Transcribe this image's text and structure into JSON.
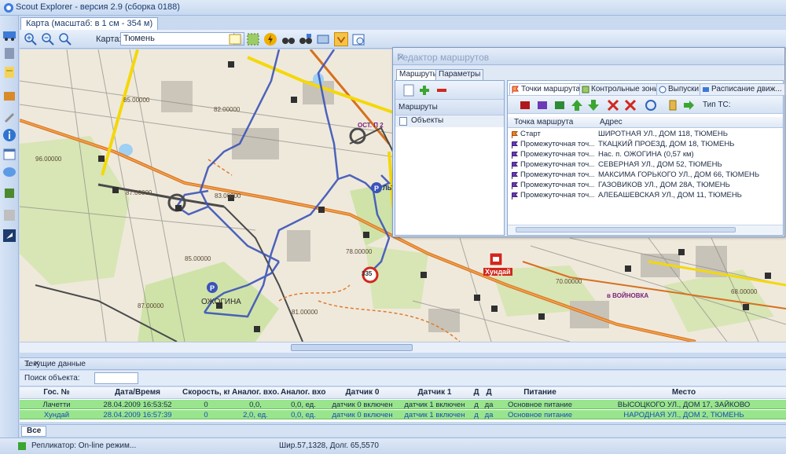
{
  "window": {
    "title": "Scout Explorer - версия 2.9 (сборка 0188)"
  },
  "map_tab": {
    "label": "Карта (масштаб: в 1 см - 354 м)"
  },
  "map_toolbar": {
    "map_label": "Карта:",
    "map_value": "Тюмень"
  },
  "map": {
    "elevations": [
      "85.00000",
      "96.00000",
      "82.00000",
      "87.00000",
      "83.00000",
      "85.00000",
      "87.00000",
      "78.00000",
      "81.00000",
      "70.00000",
      "68.00000"
    ],
    "place_label": "ОЖОГИНА",
    "district_label": "в ВОЙНОВКА",
    "car_label": "Хундай",
    "hotel_label": "ОСТ. П 2",
    "parking_label": "ЛЬТ",
    "cam_label": "335"
  },
  "route_editor": {
    "title": "Редактор маршрутов",
    "tabs": [
      "Маршруты",
      "Параметры"
    ],
    "routes_header": "Маршруты",
    "routes": [
      "Объекты"
    ],
    "right_tabs": [
      "Точки маршрута",
      "Контрольные зоны",
      "Выпуски",
      "Расписание  движ..."
    ],
    "ts_type_label": "Тип ТС:",
    "columns": [
      "Точка маршрута",
      "Адрес"
    ],
    "points": [
      {
        "type": "Старт",
        "address": "ШИРОТНАЯ УЛ., ДОМ 118, ТЮМЕНЬ"
      },
      {
        "type": "Промежуточная точ...",
        "address": "ТКАЦКИЙ ПРОЕЗД, ДОМ 18, ТЮМЕНЬ"
      },
      {
        "type": "Промежуточная точ...",
        "address": "Нас. п. ОЖОГИНА (0,57 км)"
      },
      {
        "type": "Промежуточная точ...",
        "address": "СЕВЕРНАЯ УЛ., ДОМ 52, ТЮМЕНЬ"
      },
      {
        "type": "Промежуточная точ...",
        "address": "МАКСИМА ГОРЬКОГО УЛ., ДОМ 66, ТЮМЕНЬ"
      },
      {
        "type": "Промежуточная точ...",
        "address": "ГАЗОВИКОВ УЛ., ДОМ 28А, ТЮМЕНЬ"
      },
      {
        "type": "Промежуточная точ...",
        "address": "АЛЕБАШЕВСКАЯ УЛ., ДОМ 11, ТЮМЕНЬ"
      }
    ]
  },
  "current_data": {
    "title": "Текущие данные",
    "search_label": "Поиск объекта:",
    "search_value": "",
    "columns": [
      "Гос. №",
      "Дата/Время",
      "Скорость, км/ч",
      "Аналог. вхо...",
      "Аналог. вхо...",
      "Датчик 0",
      "Датчик 1",
      "Д",
      "Д",
      "Питание",
      "Место"
    ],
    "rows": [
      [
        "Лачетти",
        "28.04.2009 16:53:52",
        "0",
        "0,0,",
        "0,0, ед.",
        "датчик 0 включен",
        "датчик 1 включен",
        "д",
        "да",
        "Основное питание",
        "ВЫСОЦКОГО УЛ., ДОМ 17, ЗАЙКОВО"
      ],
      [
        "Хундай",
        "28.04.2009 16:57:39",
        "0",
        "2,0, ед.",
        "0,0, ед.",
        "датчик 0 включен",
        "датчик 1 включен",
        "д",
        "да",
        "Основное питание",
        "НАРОДНАЯ УЛ., ДОМ 2, ТЮМЕНЬ"
      ]
    ],
    "bottom_tab": "Все"
  },
  "status": {
    "replicator": "Репликатор: On-line режим...",
    "coords": "Шир.57,1328, Долг. 65,5570"
  }
}
